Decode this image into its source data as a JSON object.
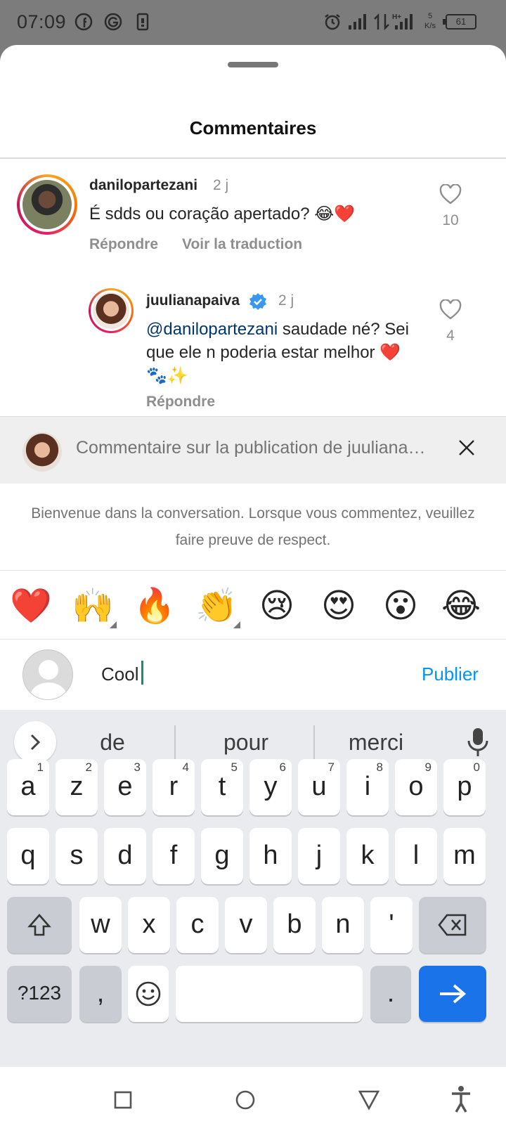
{
  "status": {
    "time": "07:09",
    "battery": "61",
    "net_speed_value": "5",
    "net_speed_unit": "K/s"
  },
  "sheet": {
    "title": "Commentaires"
  },
  "comments": [
    {
      "username": "danilopartezani",
      "ago": "2 j",
      "text": "É sdds ou coração apertado? 😂❤️",
      "reply_label": "Répondre",
      "translate_label": "Voir la traduction",
      "likes": "10"
    },
    {
      "username": "juulianapaiva",
      "verified": true,
      "ago": "2 j",
      "mention": "@danilopartezani",
      "text": " saudade né? Sei que ele n poderia estar melhor ❤️🐾✨",
      "reply_label": "Répondre",
      "likes": "4"
    }
  ],
  "reply_bar": {
    "text": "Commentaire sur la publication de juuliana…"
  },
  "welcome": {
    "text": "Bienvenue dans la conversation. Lorsque vous commentez, veuillez faire preuve de respect."
  },
  "emojis": [
    "❤️",
    "🙌",
    "🔥",
    "👏",
    "😢",
    "😍",
    "😮",
    "😂"
  ],
  "compose": {
    "value": "Cool",
    "publish_label": "Publier"
  },
  "keyboard": {
    "suggestions": [
      "de",
      "pour",
      "merci"
    ],
    "row1": [
      {
        "k": "a",
        "n": "1"
      },
      {
        "k": "z",
        "n": "2"
      },
      {
        "k": "e",
        "n": "3"
      },
      {
        "k": "r",
        "n": "4"
      },
      {
        "k": "t",
        "n": "5"
      },
      {
        "k": "y",
        "n": "6"
      },
      {
        "k": "u",
        "n": "7"
      },
      {
        "k": "i",
        "n": "8"
      },
      {
        "k": "o",
        "n": "9"
      },
      {
        "k": "p",
        "n": "0"
      }
    ],
    "row2": [
      "q",
      "s",
      "d",
      "f",
      "g",
      "h",
      "j",
      "k",
      "l",
      "m"
    ],
    "row3": [
      "w",
      "x",
      "c",
      "v",
      "b",
      "n",
      "'"
    ],
    "symbols_label": "?123",
    "comma_label": ",",
    "period_label": "."
  },
  "colors": {
    "accent": "#0095f6",
    "send_key": "#1a73e8",
    "heart": "#e0245e"
  }
}
